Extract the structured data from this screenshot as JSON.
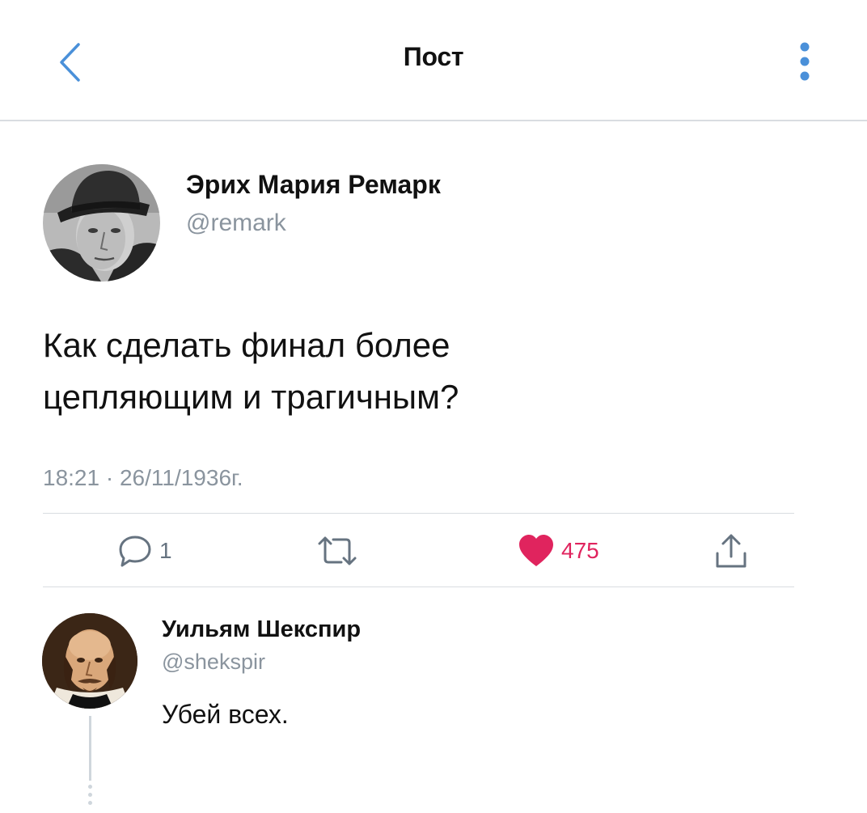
{
  "header": {
    "title": "Пост",
    "back_icon": "chevron-left-icon",
    "more_icon": "vertical-dots-icon",
    "accent_color": "#4a90d9"
  },
  "post": {
    "author_name": "Эрих Мария Ремарк",
    "author_handle": "@remark",
    "text": "Как сделать финал более\nцепляющим и трагичным?",
    "timestamp": "18:21  ·  26/11/1936г.",
    "actions": {
      "reply_icon": "comment-bubble-icon",
      "reply_count": "1",
      "retweet_icon": "retweet-icon",
      "like_icon": "heart-filled-icon",
      "like_count": "475",
      "like_color": "#e0245e",
      "share_icon": "share-upload-icon"
    }
  },
  "reply": {
    "author_name": "Уильям Шекспир",
    "author_handle": "@shekspir",
    "text": "Убей всех."
  }
}
